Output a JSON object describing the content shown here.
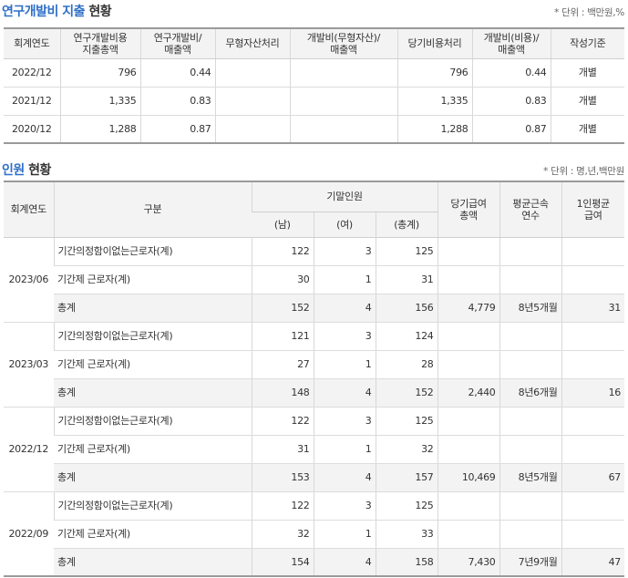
{
  "rnd": {
    "title_part1": "연구개발비 지출",
    "title_part2": "현황",
    "unit": "* 단위 : 백만원,%",
    "headers": {
      "fiscal_year": "회계연도",
      "total_line1": "연구개발비용",
      "total_line2": "지출총액",
      "ratio_line1": "연구개발비/",
      "ratio_line2": "매출액",
      "intangible": "무형자산처리",
      "int_ratio_line1": "개발비(무형자산)/",
      "int_ratio_line2": "매출액",
      "expense": "당기비용처리",
      "exp_ratio_line1": "개발비(비용)/",
      "exp_ratio_line2": "매출액",
      "basis": "작성기준"
    },
    "rows": [
      {
        "year": "2022/12",
        "total": "796",
        "ratio": "0.44",
        "intangible": "",
        "int_ratio": "",
        "expense": "796",
        "exp_ratio": "0.44",
        "basis": "개별"
      },
      {
        "year": "2021/12",
        "total": "1,335",
        "ratio": "0.83",
        "intangible": "",
        "int_ratio": "",
        "expense": "1,335",
        "exp_ratio": "0.83",
        "basis": "개별"
      },
      {
        "year": "2020/12",
        "total": "1,288",
        "ratio": "0.87",
        "intangible": "",
        "int_ratio": "",
        "expense": "1,288",
        "exp_ratio": "0.87",
        "basis": "개별"
      }
    ]
  },
  "staff": {
    "title_part1": "인원",
    "title_part2": "현황",
    "unit": "* 단위 : 명,년,백만원",
    "headers": {
      "fiscal_year": "회계연도",
      "category": "구분",
      "headcount": "기말인원",
      "male": "(남)",
      "female": "(여)",
      "total": "(총계)",
      "salary_line1": "당기급여",
      "salary_line2": "총액",
      "tenure_line1": "평균근속",
      "tenure_line2": "연수",
      "avg_line1": "1인평균",
      "avg_line2": "급여"
    },
    "groups": [
      {
        "year": "2023/06",
        "rows": [
          {
            "label": "기간의정함이없는근로자(계)",
            "male": "122",
            "female": "3",
            "total": "125",
            "salary": "",
            "tenure": "",
            "avg": ""
          },
          {
            "label": "기간제 근로자(계)",
            "male": "30",
            "female": "1",
            "total": "31",
            "salary": "",
            "tenure": "",
            "avg": ""
          },
          {
            "label": "총계",
            "male": "152",
            "female": "4",
            "total": "156",
            "salary": "4,779",
            "tenure": "8년5개월",
            "avg": "31"
          }
        ]
      },
      {
        "year": "2023/03",
        "rows": [
          {
            "label": "기간의정함이없는근로자(계)",
            "male": "121",
            "female": "3",
            "total": "124",
            "salary": "",
            "tenure": "",
            "avg": ""
          },
          {
            "label": "기간제 근로자(계)",
            "male": "27",
            "female": "1",
            "total": "28",
            "salary": "",
            "tenure": "",
            "avg": ""
          },
          {
            "label": "총계",
            "male": "148",
            "female": "4",
            "total": "152",
            "salary": "2,440",
            "tenure": "8년6개월",
            "avg": "16"
          }
        ]
      },
      {
        "year": "2022/12",
        "rows": [
          {
            "label": "기간의정함이없는근로자(계)",
            "male": "122",
            "female": "3",
            "total": "125",
            "salary": "",
            "tenure": "",
            "avg": ""
          },
          {
            "label": "기간제 근로자(계)",
            "male": "31",
            "female": "1",
            "total": "32",
            "salary": "",
            "tenure": "",
            "avg": ""
          },
          {
            "label": "총계",
            "male": "153",
            "female": "4",
            "total": "157",
            "salary": "10,469",
            "tenure": "8년5개월",
            "avg": "67"
          }
        ]
      },
      {
        "year": "2022/09",
        "rows": [
          {
            "label": "기간의정함이없는근로자(계)",
            "male": "122",
            "female": "3",
            "total": "125",
            "salary": "",
            "tenure": "",
            "avg": ""
          },
          {
            "label": "기간제 근로자(계)",
            "male": "32",
            "female": "1",
            "total": "33",
            "salary": "",
            "tenure": "",
            "avg": ""
          },
          {
            "label": "총계",
            "male": "154",
            "female": "4",
            "total": "158",
            "salary": "7,430",
            "tenure": "7년9개월",
            "avg": "47"
          }
        ]
      }
    ]
  }
}
